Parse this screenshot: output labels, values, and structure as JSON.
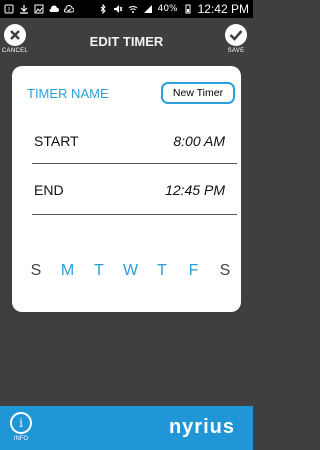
{
  "status_bar": {
    "battery_percent": "40%",
    "time": "12:42 PM",
    "icons": [
      "notification-icon",
      "download-icon",
      "image-icon",
      "cloud-icon",
      "cloud-check-icon",
      "bluetooth-icon",
      "mute-icon",
      "wifi-icon",
      "signal-icon",
      "battery-icon"
    ]
  },
  "header": {
    "title": "EDIT TIMER",
    "cancel_label": "CANCEL",
    "save_label": "SAVE"
  },
  "timer": {
    "name_label": "TIMER NAME",
    "name_value": "New Timer",
    "start_label": "START",
    "start_time": "8:00 AM",
    "end_label": "END",
    "end_time": "12:45 PM"
  },
  "days": [
    {
      "letter": "S",
      "selected": false
    },
    {
      "letter": "M",
      "selected": true
    },
    {
      "letter": "T",
      "selected": true
    },
    {
      "letter": "W",
      "selected": true
    },
    {
      "letter": "T",
      "selected": true
    },
    {
      "letter": "F",
      "selected": true
    },
    {
      "letter": "S",
      "selected": false
    }
  ],
  "footer": {
    "info_label": "INFO",
    "brand": "nyrius"
  },
  "colors": {
    "accent": "#2b9fd9",
    "background": "#3f3f41",
    "footer": "#2196d6"
  }
}
